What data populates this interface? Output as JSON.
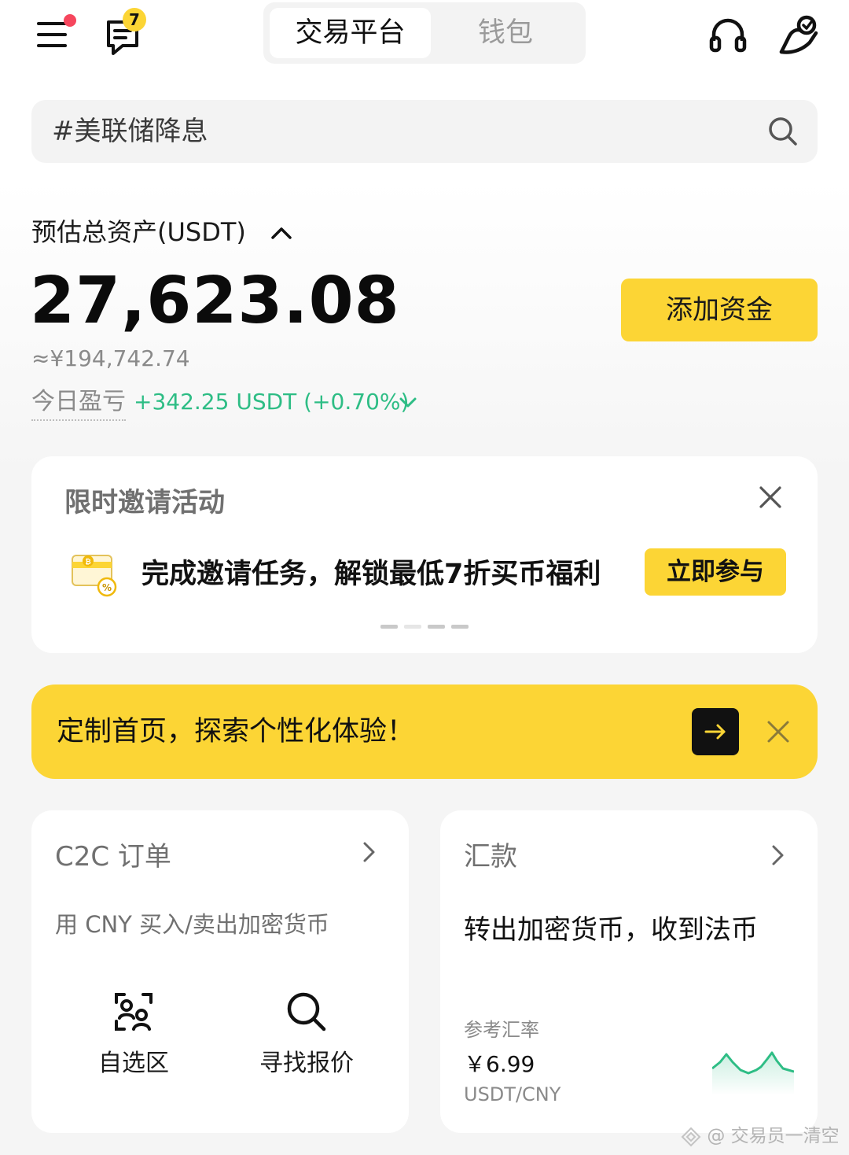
{
  "header": {
    "menu_has_notification": true,
    "message_count": "7",
    "tabs": [
      {
        "label": "交易平台",
        "active": true
      },
      {
        "label": "钱包",
        "active": false
      }
    ]
  },
  "search": {
    "placeholder": "#美联储降息"
  },
  "assets": {
    "label": "预估总资产(USDT)",
    "amount": "27,623.08",
    "cny_equivalent": "≈¥194,742.74",
    "add_funds_label": "添加资金",
    "pnl_label": "今日盈亏",
    "pnl_value": "+342.25 USDT  (+0.70%)"
  },
  "invite_card": {
    "title": "限时邀请活动",
    "text": "完成邀请任务，解锁最低7折买币福利",
    "button_label": "立即参与",
    "page_count": 4,
    "active_page": 2
  },
  "customize_banner": {
    "text": "定制首页，探索个性化体验！"
  },
  "c2c_card": {
    "title": "C2C 订单",
    "description": "用 CNY 买入/卖出加密货币",
    "actions": [
      {
        "label": "自选区",
        "icon": "favorite-merchants-icon"
      },
      {
        "label": "寻找报价",
        "icon": "search-icon"
      }
    ]
  },
  "remit_card": {
    "title": "汇款",
    "description": "转出加密货币，收到法币",
    "rate_label": "参考汇率",
    "rate_value": "￥6.99",
    "rate_pair": "USDT/CNY"
  },
  "watermark": {
    "text": "@ 交易员一清空"
  },
  "colors": {
    "accent": "#fcd535",
    "positive": "#2ebd85",
    "notification": "#f6465d"
  }
}
